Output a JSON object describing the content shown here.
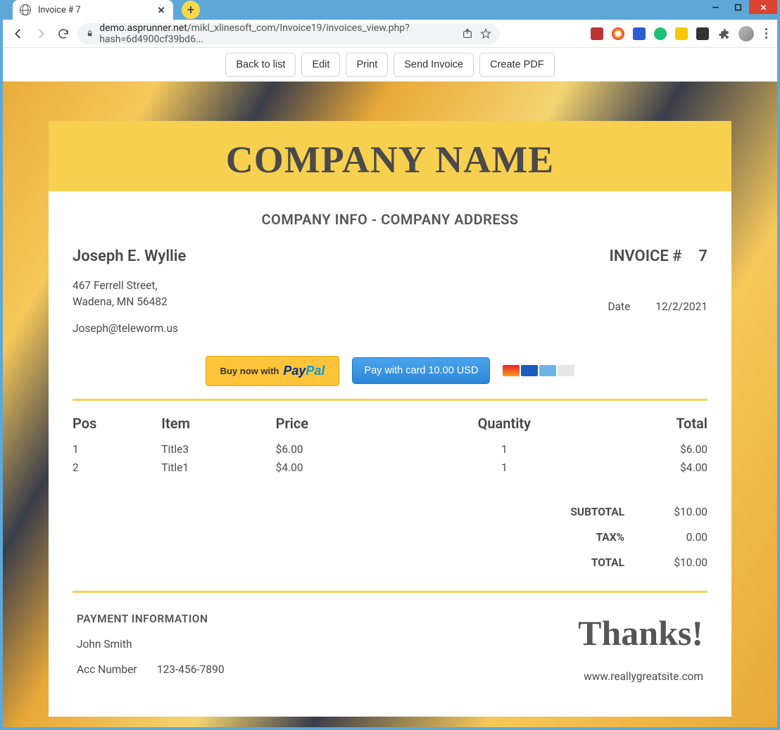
{
  "browser": {
    "tab_title": "Invoice #   7",
    "url_host": "demo.asprunner.net",
    "url_path": "/mikl_xlinesoft_com/Invoice19/invoices_view.php?hash=6d4900cf39bd6..."
  },
  "toolbar": {
    "back_to_list": "Back to list",
    "edit": "Edit",
    "print": "Print",
    "send_invoice": "Send Invoice",
    "create_pdf": "Create PDF"
  },
  "invoice": {
    "company_name": "COMPANY NAME",
    "company_info": "COMPANY INFO - COMPANY ADDRESS",
    "customer": {
      "name": "Joseph E. Wyllie",
      "address_line1": "467 Ferrell Street,",
      "address_line2": "Wadena, MN 56482",
      "email": "Joseph@teleworm.us"
    },
    "invoice_label": "INVOICE #",
    "invoice_number": "7",
    "date_label": "Date",
    "date_value": "12/2/2021",
    "paypal_prefix": "Buy now with",
    "card_button": "Pay with card 10.00 USD",
    "columns": {
      "pos": "Pos",
      "item": "Item",
      "price": "Price",
      "qty": "Quantity",
      "total": "Total"
    },
    "line_items": [
      {
        "pos": "1",
        "item": "Title3",
        "price": "$6.00",
        "qty": "1",
        "total": "$6.00"
      },
      {
        "pos": "2",
        "item": "Title1",
        "price": "$4.00",
        "qty": "1",
        "total": "$4.00"
      }
    ],
    "totals": {
      "subtotal_label": "SUBTOTAL",
      "subtotal": "$10.00",
      "tax_label": "TAX%",
      "tax": "0.00",
      "total_label": "TOTAL",
      "total": "$10.00"
    },
    "payment_info": {
      "title": "PAYMENT INFORMATION",
      "payee": "John Smith",
      "acc_label": "Acc Number",
      "acc_number": "123-456-7890"
    },
    "thanks": "Thanks!",
    "website": "www.reallygreatsite.com"
  }
}
